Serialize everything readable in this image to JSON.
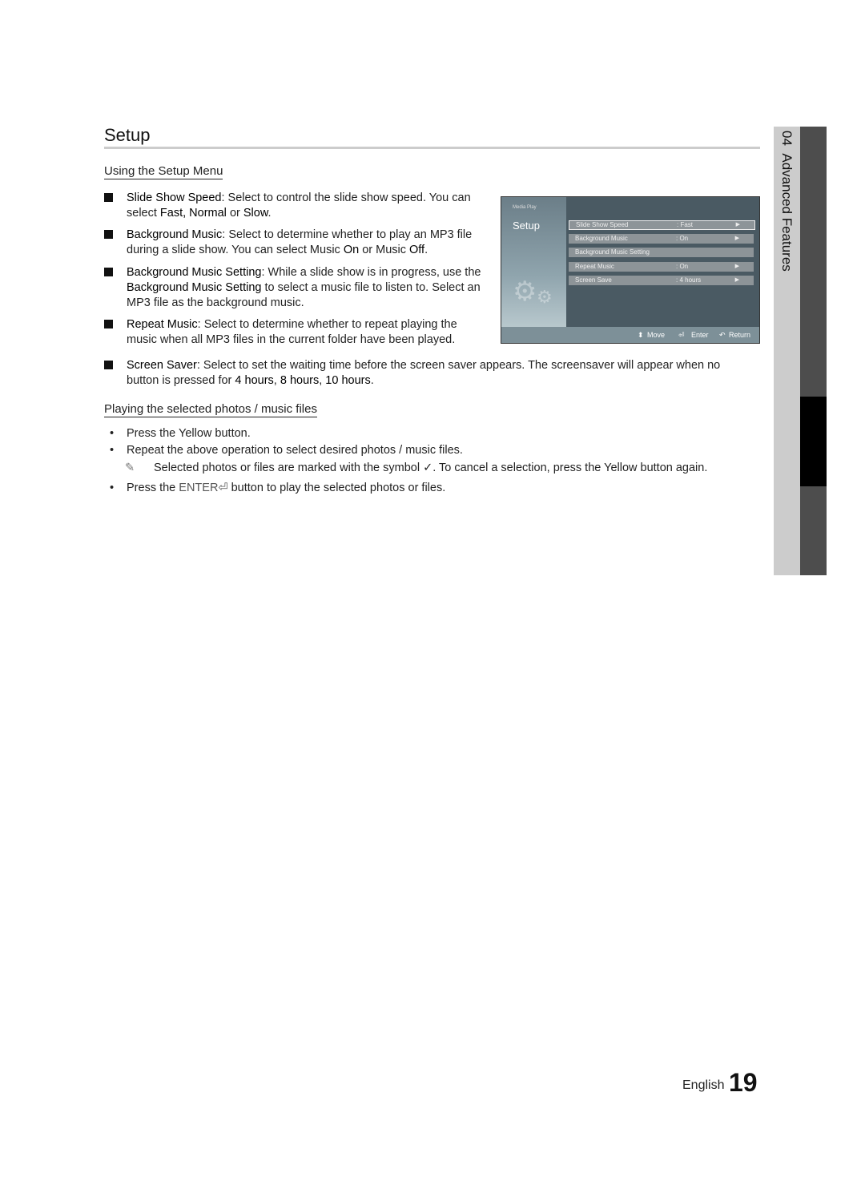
{
  "title": "Setup",
  "section1": {
    "heading": "Using the Setup Menu",
    "items": [
      {
        "term": "Slide Show Speed",
        "text": ": Select to control the slide show speed. You can select ",
        "o1": "Fast, Normal",
        "mid": " or ",
        "o2": "Slow",
        "end": "."
      },
      {
        "term": "Background Music",
        "text": ": Select to determine whether to play an MP3 file during a slide show. You can select Music ",
        "o1": "On",
        "mid": " or Music ",
        "o2": "Off",
        "end": "."
      },
      {
        "term": "Background Music Setting",
        "text": ": While a slide show is in progress, use the ",
        "o1": "Background Music Setting",
        "mid": " to select a music file to listen to. Select an MP3 file as the background music.",
        "o2": "",
        "end": ""
      },
      {
        "term": "Repeat Music",
        "text": ": Select to determine whether to repeat playing the music when all MP3 files in the current folder have been played.",
        "o1": "",
        "mid": "",
        "o2": "",
        "end": ""
      },
      {
        "term": "Screen Saver",
        "text": ": Select to set the waiting time before the screen saver appears. The screensaver will appear when no button is pressed for ",
        "o1": "4 hours",
        "mid": ", ",
        "o2": "8 hours",
        "end": ", ",
        "o3": "10 hours",
        "end2": "."
      }
    ]
  },
  "osd": {
    "logo": "Media Play",
    "title": "Setup",
    "rows": [
      {
        "label": "Slide Show Speed",
        "value": ": Fast"
      },
      {
        "label": "Background Music",
        "value": ": On"
      },
      {
        "label": "Background Music Setting",
        "value": ""
      },
      {
        "label": "Repeat Music",
        "value": ": On"
      },
      {
        "label": "Screen Save",
        "value": ": 4 hours"
      }
    ],
    "footer": {
      "move": "Move",
      "enter": "Enter",
      "return": "Return"
    }
  },
  "section2": {
    "heading": "Playing the selected photos / music files",
    "b1": "Press the Yellow button.",
    "b2": "Repeat the above operation to select desired photos / music files.",
    "note_a": "Selected photos or files are marked with the symbol ",
    "note_b": ". To cancel a selection, press the Yellow button again.",
    "b3a": "Press the ",
    "b3enter": "ENTER",
    "b3b": " button to play the selected photos or files."
  },
  "side_tab": {
    "number": "04",
    "label": "Advanced Features"
  },
  "footer": {
    "language": "English",
    "page": "19"
  }
}
